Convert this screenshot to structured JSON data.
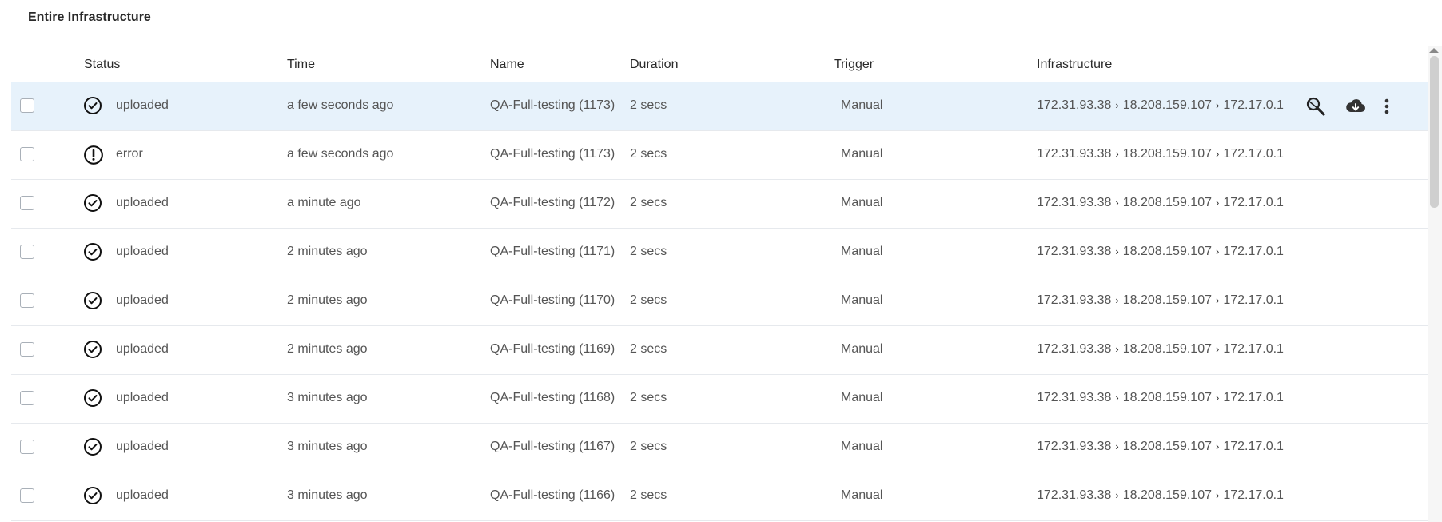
{
  "section_title": "Entire Infrastructure",
  "columns": {
    "status": "Status",
    "time": "Time",
    "name": "Name",
    "duration": "Duration",
    "trigger": "Trigger",
    "infrastructure": "Infrastructure"
  },
  "infra_separator": "›",
  "rows": [
    {
      "status": "uploaded",
      "status_icon": "check-circle-icon",
      "time": "a few seconds ago",
      "name": "QA-Full-testing (1173)",
      "duration": "2 secs",
      "trigger": "Manual",
      "infra": [
        "172.31.93.38",
        "18.208.159.107",
        "172.17.0.1"
      ]
    },
    {
      "status": "error",
      "status_icon": "error-circle-icon",
      "time": "a few seconds ago",
      "name": "QA-Full-testing (1173)",
      "duration": "2 secs",
      "trigger": "Manual",
      "infra": [
        "172.31.93.38",
        "18.208.159.107",
        "172.17.0.1"
      ]
    },
    {
      "status": "uploaded",
      "status_icon": "check-circle-icon",
      "time": "a minute ago",
      "name": "QA-Full-testing (1172)",
      "duration": "2 secs",
      "trigger": "Manual",
      "infra": [
        "172.31.93.38",
        "18.208.159.107",
        "172.17.0.1"
      ]
    },
    {
      "status": "uploaded",
      "status_icon": "check-circle-icon",
      "time": "2 minutes ago",
      "name": "QA-Full-testing (1171)",
      "duration": "2 secs",
      "trigger": "Manual",
      "infra": [
        "172.31.93.38",
        "18.208.159.107",
        "172.17.0.1"
      ]
    },
    {
      "status": "uploaded",
      "status_icon": "check-circle-icon",
      "time": "2 minutes ago",
      "name": "QA-Full-testing (1170)",
      "duration": "2 secs",
      "trigger": "Manual",
      "infra": [
        "172.31.93.38",
        "18.208.159.107",
        "172.17.0.1"
      ]
    },
    {
      "status": "uploaded",
      "status_icon": "check-circle-icon",
      "time": "2 minutes ago",
      "name": "QA-Full-testing (1169)",
      "duration": "2 secs",
      "trigger": "Manual",
      "infra": [
        "172.31.93.38",
        "18.208.159.107",
        "172.17.0.1"
      ]
    },
    {
      "status": "uploaded",
      "status_icon": "check-circle-icon",
      "time": "3 minutes ago",
      "name": "QA-Full-testing (1168)",
      "duration": "2 secs",
      "trigger": "Manual",
      "infra": [
        "172.31.93.38",
        "18.208.159.107",
        "172.17.0.1"
      ]
    },
    {
      "status": "uploaded",
      "status_icon": "check-circle-icon",
      "time": "3 minutes ago",
      "name": "QA-Full-testing (1167)",
      "duration": "2 secs",
      "trigger": "Manual",
      "infra": [
        "172.31.93.38",
        "18.208.159.107",
        "172.17.0.1"
      ]
    },
    {
      "status": "uploaded",
      "status_icon": "check-circle-icon",
      "time": "3 minutes ago",
      "name": "QA-Full-testing (1166)",
      "duration": "2 secs",
      "trigger": "Manual",
      "infra": [
        "172.31.93.38",
        "18.208.159.107",
        "172.17.0.1"
      ]
    }
  ],
  "row_actions": [
    "analyze-icon",
    "cloud-download-icon",
    "more-vert-icon"
  ],
  "colors": {
    "selected_row": "#e7f2fb",
    "border": "#e6e9ed",
    "text": "#555555"
  }
}
